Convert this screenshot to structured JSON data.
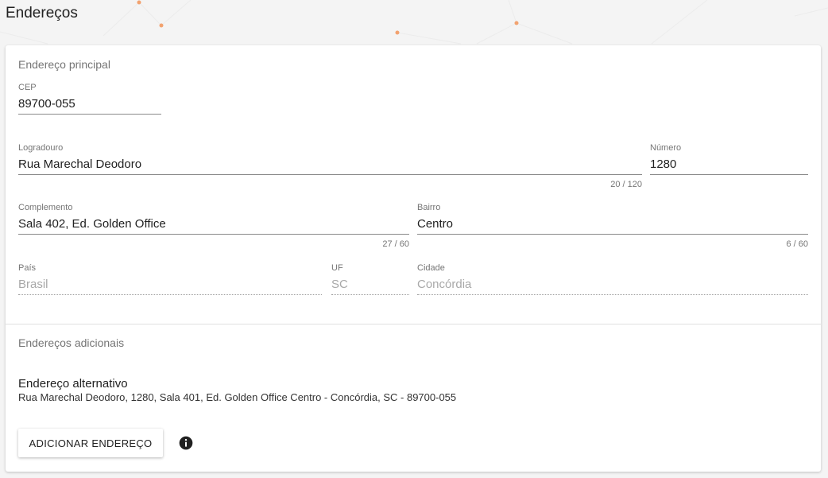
{
  "page": {
    "title": "Endereços"
  },
  "main_address": {
    "section_title": "Endereço principal",
    "fields": {
      "cep": {
        "label": "CEP",
        "value": "89700-055"
      },
      "logradouro": {
        "label": "Logradouro",
        "value": "Rua Marechal Deodoro",
        "counter": "20 / 120"
      },
      "numero": {
        "label": "Número",
        "value": "1280"
      },
      "complemento": {
        "label": "Complemento",
        "value": "Sala 402, Ed. Golden Office",
        "counter": "27 / 60"
      },
      "bairro": {
        "label": "Bairro",
        "value": "Centro",
        "counter": "6 / 60"
      },
      "pais": {
        "label": "País",
        "value": "Brasil"
      },
      "uf": {
        "label": "UF",
        "value": "SC"
      },
      "cidade": {
        "label": "Cidade",
        "value": "Concórdia"
      }
    }
  },
  "additional": {
    "section_title": "Endereços adicionais",
    "items": [
      {
        "title": "Endereço alternativo",
        "line": "Rua Marechal Deodoro, 1280, Sala 401, Ed. Golden Office Centro - Concórdia, SC - 89700-055"
      }
    ],
    "add_button_label": "ADICIONAR ENDEREÇO",
    "info_icon": "info-icon"
  },
  "colors": {
    "accent_dots": "#f2a26f",
    "background": "#f4f4f4"
  }
}
